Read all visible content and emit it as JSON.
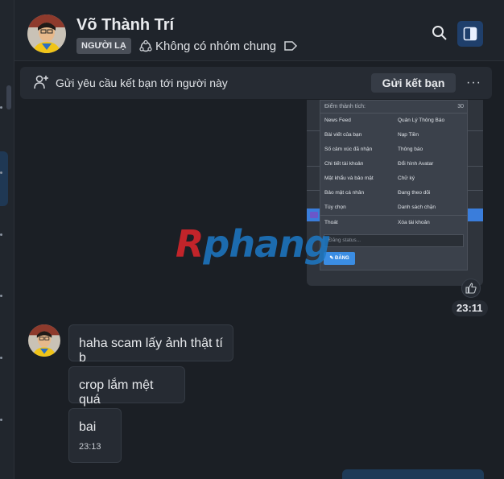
{
  "contact": {
    "name": "Võ Thành Trí",
    "badge": "NGƯỜI LẠ",
    "groups_text": "Không có nhóm chung"
  },
  "friend_request": {
    "message": "Gửi yêu cầu kết bạn tới người này",
    "button": "Gửi kết bạn",
    "more": "···"
  },
  "image_message": {
    "header_label": "Điểm thành tích:",
    "header_value": "30",
    "menu_items": [
      "News Feed",
      "Quản Lý Thông Báo",
      "Bài viết của bạn",
      "Nạp Tiền",
      "Số cảm xúc đã nhận",
      "Thông báo",
      "Chi tiết tài khoản",
      "Đổi hình Avatar",
      "Mật khẩu và bảo mật",
      "Chữ ký",
      "Bảo mật cá nhân",
      "Đang theo dõi",
      "Tùy chọn",
      "Danh sách chặn",
      "Thoát",
      "Xóa tài khoản"
    ],
    "status_placeholder": "Đăng status...",
    "post_button": "✎ ĐĂNG",
    "watermark_r": "R",
    "watermark_rest": "phang",
    "time": "23:11"
  },
  "messages": [
    {
      "text": "haha scam lấy ảnh thật tí b"
    },
    {
      "text": "crop lắm mệt quá"
    },
    {
      "text": "bai",
      "time": "23:13"
    }
  ],
  "colors": {
    "accent": "#1f3f6b",
    "background": "#1b1f25",
    "bubble": "#262b33"
  }
}
